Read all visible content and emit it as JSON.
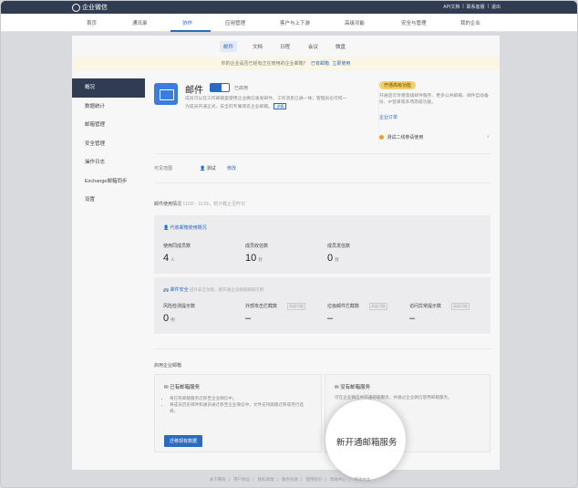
{
  "topbar": {
    "brand": "企业微信",
    "links": [
      "API文档",
      "联系客服",
      "退出"
    ]
  },
  "nav": {
    "items": [
      "首页",
      "通讯录",
      "协作",
      "应用管理",
      "客户与上下游",
      "高级功能",
      "安全与管理",
      "我的企业"
    ]
  },
  "subtabs": [
    "邮件",
    "文档",
    "日程",
    "会议",
    "微盘"
  ],
  "notice": {
    "text": "你的企业是否已经有正在使用的企业邮箱？",
    "link1": "已有邮箱",
    "link2": "立即使用"
  },
  "sidebar": {
    "items": [
      "概况",
      "数据统计",
      "邮箱管理",
      "安全管理",
      "操作日志",
      "Exchange邮箱同步",
      "设置"
    ]
  },
  "app": {
    "title": "邮件",
    "toggle_label": "已启用",
    "desc": "成员可以在工作邮箱里使用企业微信收发邮件、工作消息已通一体；管理员也可统一为成员开通正式、安全的专属域名企业邮箱。",
    "tag": "详情"
  },
  "promo": {
    "badge": "开通高级功能",
    "desc": "开通后可享受高级邮件服务、更多公共邮箱、邮件自动备份、IP登录等多项高级功能。",
    "link": "企业订单",
    "row": "测试二线券请使用"
  },
  "visible": {
    "label": "可见范围",
    "person": "测试",
    "edit": "修改"
  },
  "usage": {
    "title": "邮件使用情况",
    "range": "11/20 - 11/26，统计截止至昨日"
  },
  "card1": {
    "head": "代收邮箱使用概况",
    "stats": [
      {
        "label": "使用同成员数",
        "value": "4",
        "unit": "人"
      },
      {
        "label": "成员收信数",
        "value": "10",
        "unit": "封"
      },
      {
        "label": "成员发信数",
        "value": "0",
        "unit": "封"
      }
    ]
  },
  "card2": {
    "head": "邮件安全",
    "head_note": "提升安全功能，暂开通企业邮箱邮箱可用",
    "stats": [
      {
        "label": "风险检测提示数",
        "value": "0",
        "unit": "例"
      },
      {
        "label": "外部攻击拦截数",
        "value": "–",
        "tag": "高级功能"
      },
      {
        "label": "垃圾邮件拦截数",
        "value": "–",
        "tag": "高级功能"
      },
      {
        "label": "访问异常提示数",
        "value": "–",
        "tag": "高级功能"
      }
    ]
  },
  "enterprise": {
    "title": "启用企业邮箱",
    "box1_title": "已有邮箱服务",
    "box1_items": [
      "将已有邮箱服务迁移至企业微信中。",
      "将成员历史邮件和通讯录迁移至企业微信中，文件支持跟随迁移或另行选择。"
    ],
    "box1_button": "迁移现有数据",
    "box2_title": "没有邮箱服务",
    "box2_desc": "可在企业微信中开通邮箱服务，并通过企业微信使用邮箱服务。"
  },
  "spotlight": "新开通邮箱服务",
  "footer": [
    "关于腾讯",
    "用户协议",
    "隐私政策",
    "服务条款",
    "使用指引",
    "帮助中心",
    "简体中文"
  ]
}
